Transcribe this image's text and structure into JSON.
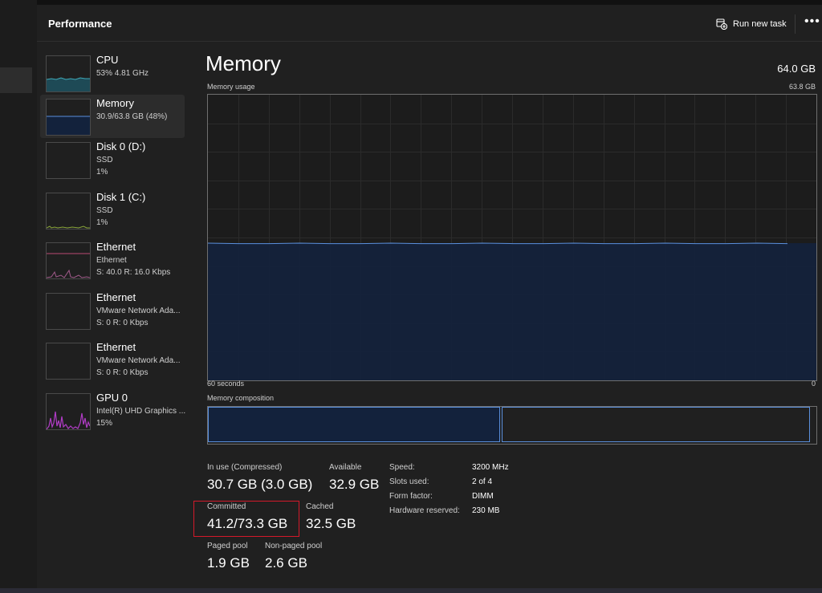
{
  "header": {
    "title": "Performance",
    "run_task_label": "Run new task",
    "more_label": "•••"
  },
  "sidebar": {
    "items": [
      {
        "name": "CPU",
        "line1": "53%  4.81 GHz",
        "line2": "",
        "thumb": "cpu-graph"
      },
      {
        "name": "Memory",
        "line1": "30.9/63.8 GB (48%)",
        "line2": "",
        "thumb": "memory-graph"
      },
      {
        "name": "Disk 0 (D:)",
        "line1": "SSD",
        "line2": "1%",
        "thumb": "disk-graph"
      },
      {
        "name": "Disk 1 (C:)",
        "line1": "SSD",
        "line2": "1%",
        "thumb": "disk-graph"
      },
      {
        "name": "Ethernet",
        "line1": "Ethernet",
        "line2": "S: 40.0  R: 16.0 Kbps",
        "thumb": "ethernet-graph"
      },
      {
        "name": "Ethernet",
        "line1": "VMware Network Ada...",
        "line2": "S: 0  R: 0 Kbps",
        "thumb": "ethernet-graph"
      },
      {
        "name": "Ethernet",
        "line1": "VMware Network Ada...",
        "line2": "S: 0  R: 0 Kbps",
        "thumb": "ethernet-graph"
      },
      {
        "name": "GPU 0",
        "line1": "Intel(R) UHD Graphics ...",
        "line2": "15%",
        "thumb": "gpu-graph"
      }
    ]
  },
  "main": {
    "title": "Memory",
    "total": "64.0 GB",
    "usage_label": "Memory usage",
    "usage_max": "63.8 GB",
    "time_left": "60 seconds",
    "time_right": "0",
    "composition_label": "Memory composition",
    "usage_fraction": 0.48,
    "composition_fraction": 0.48
  },
  "stats": {
    "in_use_label": "In use (Compressed)",
    "in_use_value": "30.7 GB (3.0 GB)",
    "available_label": "Available",
    "available_value": "32.9 GB",
    "committed_label": "Committed",
    "committed_value": "41.2/73.3 GB",
    "cached_label": "Cached",
    "cached_value": "32.5 GB",
    "paged_label": "Paged pool",
    "paged_value": "1.9 GB",
    "nonpaged_label": "Non-paged pool",
    "nonpaged_value": "2.6 GB"
  },
  "specs": {
    "speed_label": "Speed:",
    "speed_value": "3200 MHz",
    "slots_label": "Slots used:",
    "slots_value": "2 of 4",
    "form_label": "Form factor:",
    "form_value": "DIMM",
    "hw_label": "Hardware reserved:",
    "hw_value": "230 MB"
  },
  "colors": {
    "memory_fill": "#13223c",
    "memory_line": "#5a8fdc",
    "cpu_fill": "#1e4a56",
    "cpu_line": "#3fa9b8",
    "gpu_line": "#b13cc6",
    "highlight": "#d4192a"
  }
}
